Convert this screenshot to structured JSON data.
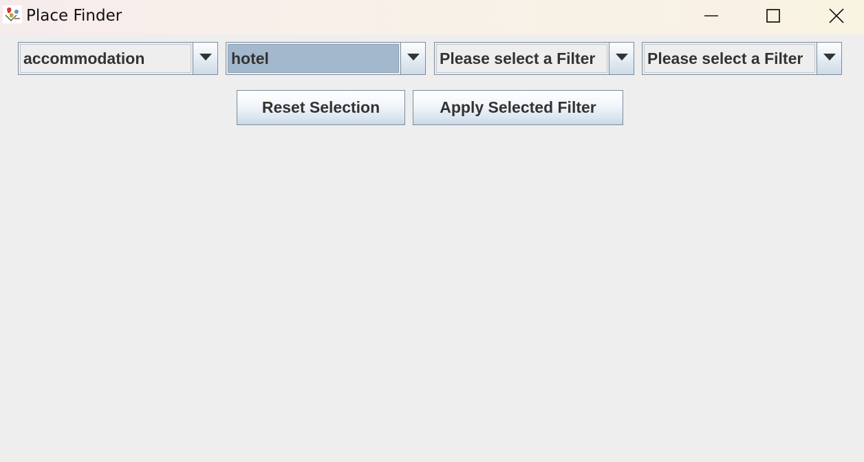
{
  "window": {
    "title": "Place Finder",
    "icon": "place-finder-app-icon",
    "controls": {
      "minimize_icon": "minimize-icon",
      "maximize_icon": "maximize-icon",
      "close_icon": "close-icon"
    }
  },
  "filters": [
    {
      "selected": "accommodation",
      "highlighted": false
    },
    {
      "selected": "hotel",
      "highlighted": true
    },
    {
      "selected": "Please select a Filter",
      "highlighted": false
    },
    {
      "selected": "Please select a Filter",
      "highlighted": false
    }
  ],
  "actions": {
    "reset_label": "Reset Selection",
    "apply_label": "Apply Selected Filter"
  },
  "colors": {
    "background": "#eeeeee",
    "selection": "#a3b8cc",
    "text": "#333333"
  }
}
